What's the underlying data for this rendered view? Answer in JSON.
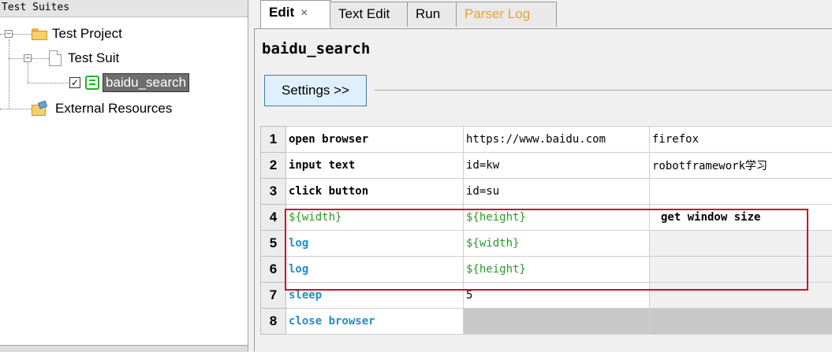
{
  "left_panel": {
    "title": "Test Suites",
    "tree": {
      "project": "Test Project",
      "suite": "Test Suit",
      "testcase": "baidu_search",
      "external": "External Resources"
    }
  },
  "tabs": [
    {
      "label": "Edit",
      "close": "×"
    },
    {
      "label": "Text Edit"
    },
    {
      "label": "Run"
    },
    {
      "label": "Parser Log"
    }
  ],
  "editor": {
    "title": "baidu_search",
    "settings_label": "Settings >>"
  },
  "grid": {
    "rows": [
      {
        "n": "1",
        "c1": "open browser",
        "c2": "https://www.baidu.com",
        "c3": "firefox"
      },
      {
        "n": "2",
        "c1": "input text",
        "c2": "id=kw",
        "c3": "robotframework学习"
      },
      {
        "n": "3",
        "c1": "click button",
        "c2": "id=su",
        "c3": ""
      },
      {
        "n": "4",
        "c1": "${width}",
        "c2": "${height}",
        "c3": "get window size"
      },
      {
        "n": "5",
        "c1": "log",
        "c2": "${width}",
        "c3": ""
      },
      {
        "n": "6",
        "c1": "log",
        "c2": "${height}",
        "c3": ""
      },
      {
        "n": "7",
        "c1": "sleep",
        "c2": "5",
        "c3": ""
      },
      {
        "n": "8",
        "c1": "close browser",
        "c2": "",
        "c3": ""
      }
    ]
  },
  "colors": {
    "keyword_blue": "#1f8fc7",
    "variable_green": "#2a9a2a",
    "highlight_red": "#c8102e",
    "parser_log_orange": "#e6a43a"
  }
}
